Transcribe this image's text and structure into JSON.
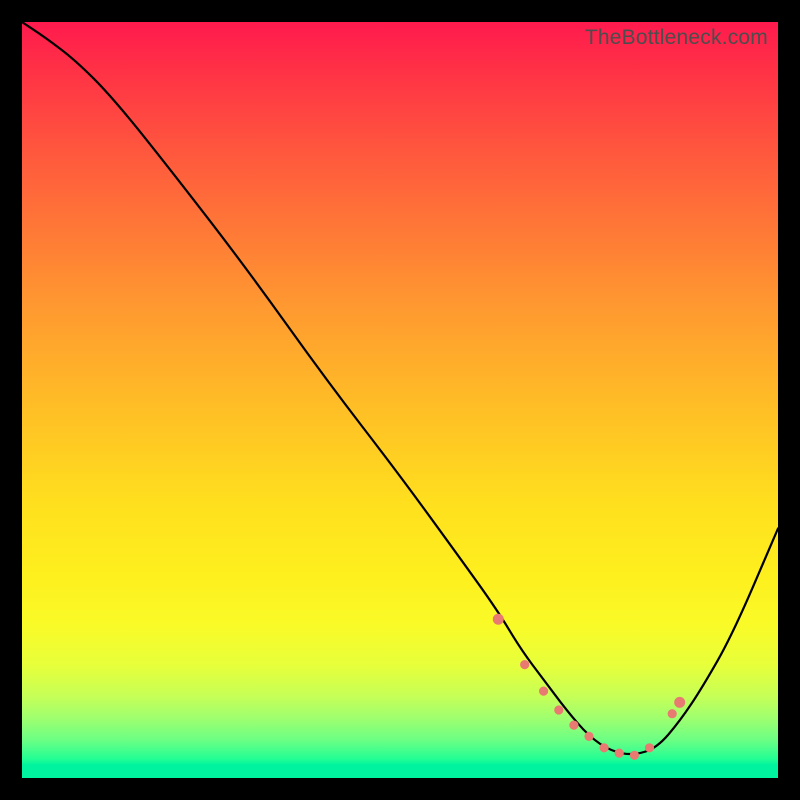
{
  "watermark": "TheBottleneck.com",
  "colors": {
    "curve": "#000000",
    "marker": "#e87a72",
    "frame": "#000000"
  },
  "chart_data": {
    "type": "line",
    "title": "",
    "xlabel": "",
    "ylabel": "",
    "xlim": [
      0,
      100
    ],
    "ylim": [
      0,
      100
    ],
    "grid": false,
    "legend": false,
    "description": "Bottleneck-style V curve over rainbow gradient; minimum near x≈75; top cropped from upper-left corner.",
    "series": [
      {
        "name": "bottleneck-curve",
        "x": [
          0,
          3,
          7,
          12,
          20,
          30,
          40,
          50,
          58,
          63,
          66,
          69,
          72,
          75,
          78,
          81,
          84,
          87,
          90,
          94,
          100
        ],
        "y": [
          100,
          98,
          95,
          90,
          80,
          67,
          53,
          40,
          29,
          22,
          17,
          13,
          9,
          5.5,
          3.5,
          3,
          4,
          7.5,
          12,
          19,
          33
        ]
      }
    ],
    "markers": [
      {
        "name": "flat-zone",
        "x": [
          63,
          66.5,
          69,
          71,
          73,
          75,
          77,
          79,
          81,
          83,
          86,
          87
        ],
        "y": [
          21,
          15,
          11.5,
          9,
          7,
          5.5,
          4,
          3.3,
          3,
          4,
          8.5,
          10
        ]
      }
    ]
  }
}
